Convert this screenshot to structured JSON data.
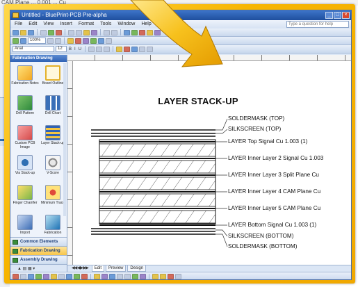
{
  "background_window": {
    "text": "CAM Plane  ...  0.001  ...  Cu"
  },
  "window": {
    "title": "Untitled - BluePrint-PCB Pre-alpha",
    "help_placeholder": "Type a question for help"
  },
  "menu": [
    "File",
    "Edit",
    "View",
    "Insert",
    "Format",
    "Tools",
    "Window",
    "Help"
  ],
  "toolbar": {
    "zoom": "100%",
    "font": "Arial",
    "font_size": "12"
  },
  "sidebar": {
    "header": "Fabrication Drawing",
    "stencils": [
      {
        "label": "Fabrication Notes"
      },
      {
        "label": "Board Outline"
      },
      {
        "label": "Drill Pattern"
      },
      {
        "label": "Drill Chart"
      },
      {
        "label": "Custom PCB Image"
      },
      {
        "label": "Layer Stack-up"
      },
      {
        "label": "Via Stack-up"
      },
      {
        "label": "V-Score"
      },
      {
        "label": "Finger Chamfer"
      },
      {
        "label": "Minimum Trace"
      },
      {
        "label": "Import"
      },
      {
        "label": "Fabrication"
      }
    ],
    "sections": [
      {
        "label": "Common Elements",
        "active": false
      },
      {
        "label": "Fabrication Drawing",
        "active": true
      },
      {
        "label": "Assembly Drawing",
        "active": false
      }
    ]
  },
  "tabs": [
    {
      "label": "Edit",
      "active": true
    },
    {
      "label": "Preview",
      "active": false
    },
    {
      "label": "Design",
      "active": false
    }
  ],
  "drawing": {
    "title": "LAYER STACK-UP",
    "labels": [
      "SOLDERMASK (TOP)",
      "SILKSCREEN (TOP)",
      "LAYER Top Signal Cu 1.003 (1)",
      "LAYER Inner Layer 2 Signal Cu 1.003",
      "LAYER Inner Layer 3 Split Plane Cu",
      "LAYER Inner Layer 4 CAM Plane Cu",
      "LAYER Inner Layer 5 CAM Plane Cu",
      "LAYER Bottom Signal Cu 1.003 (1)",
      "SILKSCREEN (BOTTOM)",
      "SOLDERMASK (BOTTOM)"
    ]
  },
  "colors": {
    "frame": "#f7b500",
    "title_bar": "#2f62b5",
    "active_section": "#f7c54a"
  }
}
